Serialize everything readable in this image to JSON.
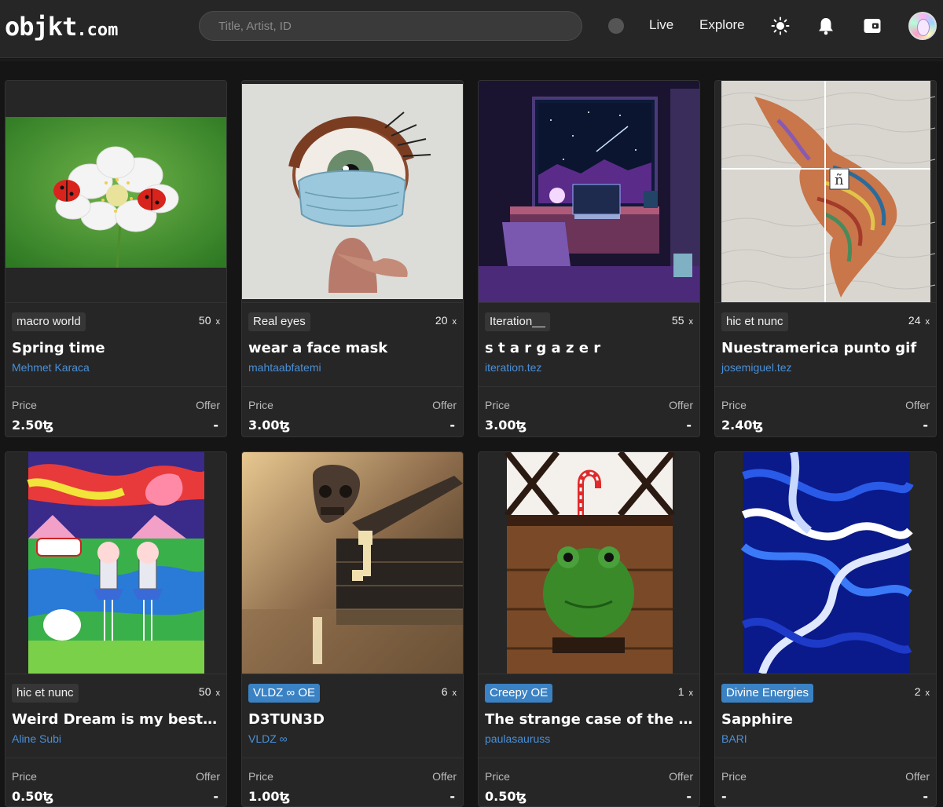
{
  "header": {
    "logo_main": "objkt",
    "logo_suffix": ".com",
    "search_placeholder": "Title, Artist, ID",
    "nav_live": "Live",
    "nav_explore": "Explore"
  },
  "cards": [
    {
      "tag": "macro world",
      "tag_blue": false,
      "editions": "50",
      "x": "x",
      "title": "Spring time",
      "artist": "Mehmet Karaca",
      "price_label": "Price",
      "offer_label": "Offer",
      "price": "2.50ꜩ",
      "offer": "-"
    },
    {
      "tag": "Real eyes",
      "tag_blue": false,
      "editions": "20",
      "x": "x",
      "title": "wear a face mask",
      "artist": "mahtaabfatemi",
      "price_label": "Price",
      "offer_label": "Offer",
      "price": "3.00ꜩ",
      "offer": "-"
    },
    {
      "tag": "Iteration__",
      "tag_blue": false,
      "editions": "55",
      "x": "x",
      "title": "s t a r g a z e r",
      "artist": "iteration.tez",
      "price_label": "Price",
      "offer_label": "Offer",
      "price": "3.00ꜩ",
      "offer": "-"
    },
    {
      "tag": "hic et nunc",
      "tag_blue": false,
      "editions": "24",
      "x": "x",
      "title": "Nuestramerica punto gif",
      "artist": "josemiguel.tez",
      "price_label": "Price",
      "offer_label": "Offer",
      "price": "2.40ꜩ",
      "offer": "-"
    },
    {
      "tag": "hic et nunc",
      "tag_blue": false,
      "editions": "50",
      "x": "x",
      "title": "Weird Dream is my best friend",
      "artist": "Aline Subi",
      "price_label": "Price",
      "offer_label": "Offer",
      "price": "0.50ꜩ",
      "offer": "-"
    },
    {
      "tag": "VLDZ ∞ OE",
      "tag_blue": true,
      "editions": "6",
      "x": "x",
      "title": "D3TUN3D",
      "artist": "VLDZ ∞",
      "price_label": "Price",
      "offer_label": "Offer",
      "price": "1.00ꜩ",
      "offer": "-"
    },
    {
      "tag": "Creepy OE",
      "tag_blue": true,
      "editions": "1",
      "x": "x",
      "title": "The strange case of the frog...",
      "artist": "paulasauruss",
      "price_label": "Price",
      "offer_label": "Offer",
      "price": "0.50ꜩ",
      "offer": "-"
    },
    {
      "tag": "Divine Energies",
      "tag_blue": true,
      "editions": "2",
      "x": "x",
      "title": "Sapphire",
      "artist": "BARI",
      "price_label": "Price",
      "offer_label": "Offer",
      "price": "-",
      "offer": "-"
    }
  ]
}
